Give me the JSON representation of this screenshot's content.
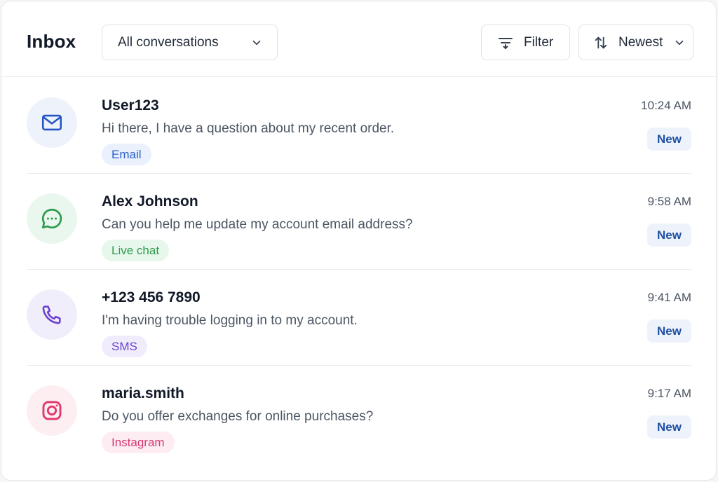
{
  "header": {
    "title": "Inbox",
    "conversation_filter": {
      "selected": "All conversations",
      "icon": "chevron-down-icon"
    },
    "filter_button": {
      "label": "Filter",
      "icon": "filter-icon"
    },
    "sort_button": {
      "label": "Newest",
      "icon": "sort-arrows-icon",
      "chevron": "chevron-down-icon"
    }
  },
  "conversations": [
    {
      "name": "User123",
      "message": "Hi there, I have a question about my recent order.",
      "channel": "Email",
      "time": "10:24 AM",
      "status": "New",
      "icon": "mail-icon",
      "colors": {
        "avatar_bg": "#edf2fb",
        "icon": "#2356c4",
        "tag_bg": "#eaf1fc",
        "tag_text": "#2a5fc6"
      }
    },
    {
      "name": "Alex Johnson",
      "message": "Can you help me update my account email address?",
      "channel": "Live chat",
      "time": "9:58 AM",
      "status": "New",
      "icon": "chat-bubble-icon",
      "colors": {
        "avatar_bg": "#eaf7ee",
        "icon": "#2e9a4c",
        "tag_bg": "#e8f7ec",
        "tag_text": "#2f9a4e"
      }
    },
    {
      "name": "+123 456 7890",
      "message": "I'm having trouble logging in to my account.",
      "channel": "SMS",
      "time": "9:41 AM",
      "status": "New",
      "icon": "phone-icon",
      "colors": {
        "avatar_bg": "#f1eefb",
        "icon": "#6a3fd0",
        "tag_bg": "#f0ecfc",
        "tag_text": "#6a43cf"
      }
    },
    {
      "name": "maria.smith",
      "message": "Do you offer exchanges for online purchases?",
      "channel": "Instagram",
      "time": "9:17 AM",
      "status": "New",
      "icon": "instagram-icon",
      "colors": {
        "avatar_bg": "#fdeef2",
        "icon": "#e0366e",
        "tag_bg": "#fdecf2",
        "tag_text": "#d63a74"
      }
    }
  ]
}
